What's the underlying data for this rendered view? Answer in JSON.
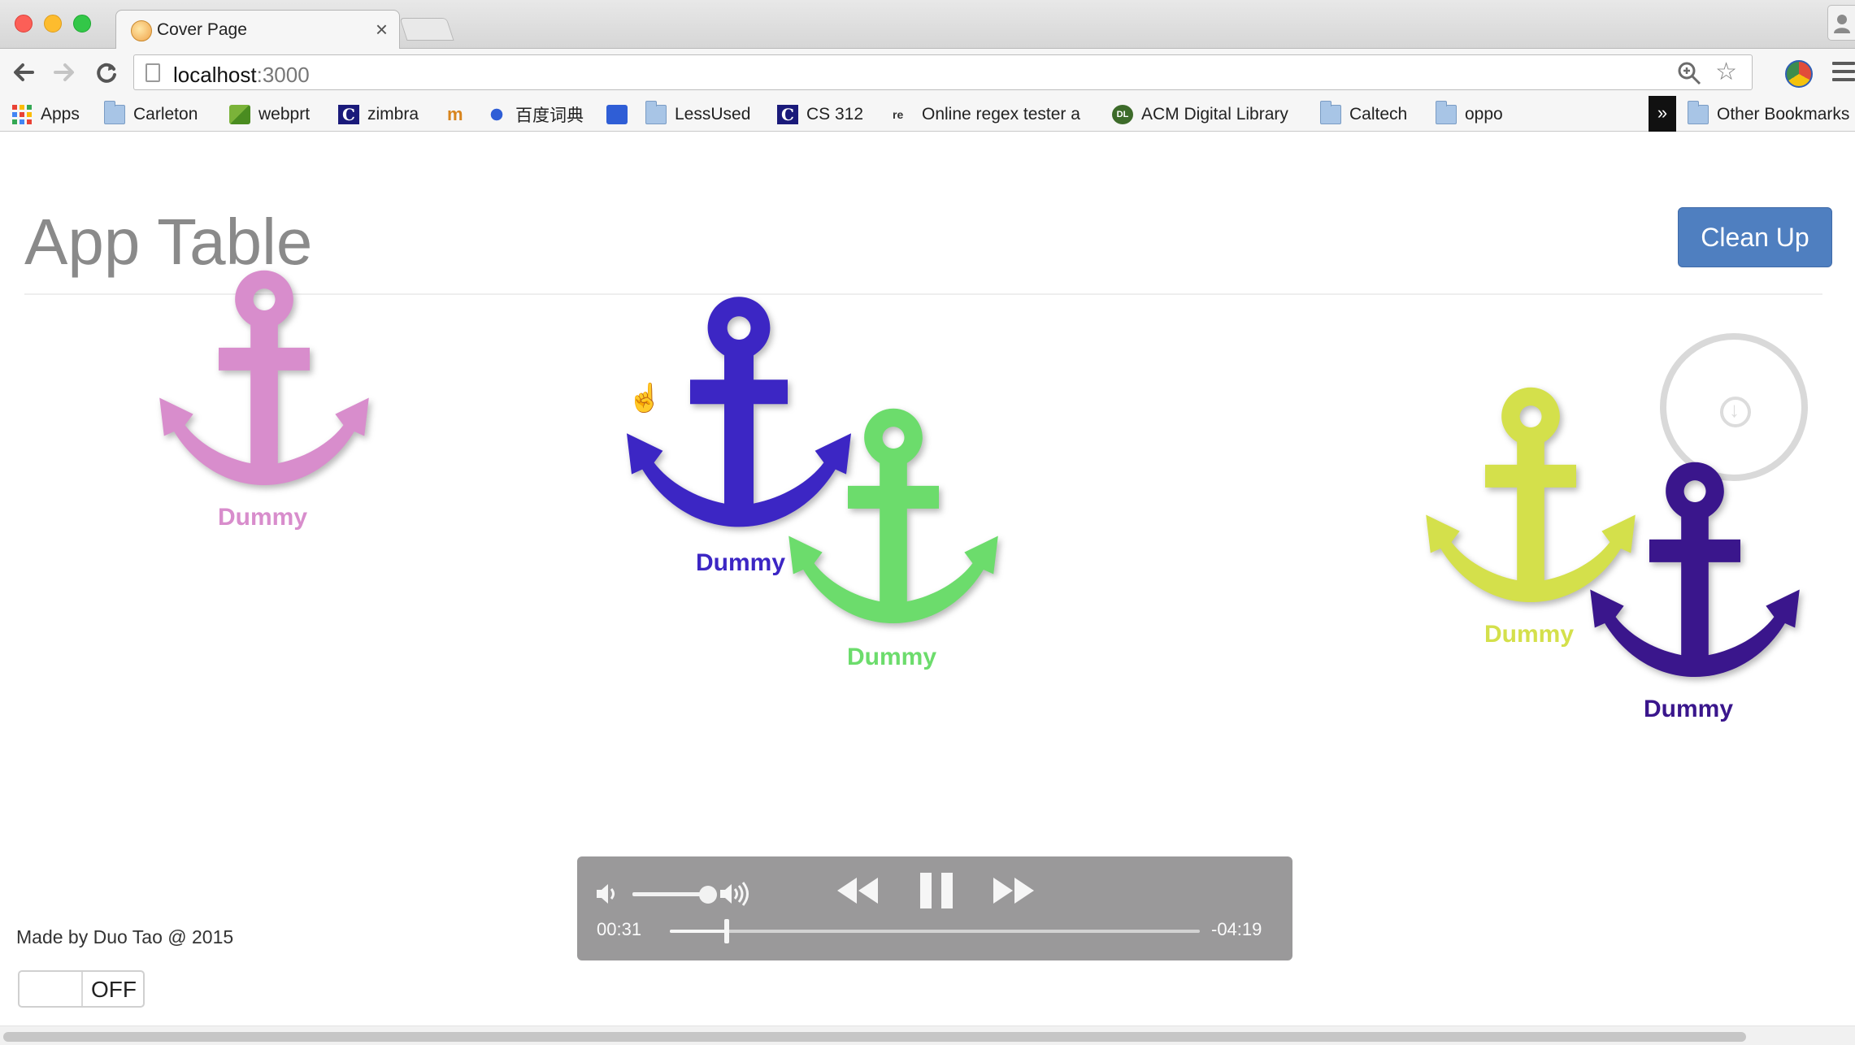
{
  "browser": {
    "tab_title": "Cover Page",
    "tab_close": "×",
    "url_host": "localhost",
    "url_port": ":3000",
    "bookmarks": {
      "apps": "Apps",
      "carleton": "Carleton",
      "webprt": "webprt",
      "zimbra": "zimbra",
      "cidian": "百度词典",
      "lessused": "LessUsed",
      "cs312": "CS 312",
      "regex": "Online regex tester a",
      "acm": "ACM Digital Library",
      "caltech": "Caltech",
      "oppo": "oppo",
      "overflow": "»",
      "other": "Other Bookmarks"
    }
  },
  "page": {
    "title": "App Table",
    "cleanup_label": "Clean Up",
    "footer": "Made by Duo Tao @ 2015",
    "toggle_label": "OFF"
  },
  "apps": [
    {
      "label": "Dummy",
      "color": "#d88dcc"
    },
    {
      "label": "Dummy",
      "color": "#3c26c4"
    },
    {
      "label": "Dummy",
      "color": "#6cdc6c"
    },
    {
      "label": "Dummy",
      "color": "#d4e04b"
    },
    {
      "label": "Dummy",
      "color": "#3a168c"
    }
  ],
  "player": {
    "current_time": "00:31",
    "remaining_time": "-04:19",
    "progress_fraction": 0.107,
    "volume_fraction": 0.9,
    "state": "playing"
  }
}
